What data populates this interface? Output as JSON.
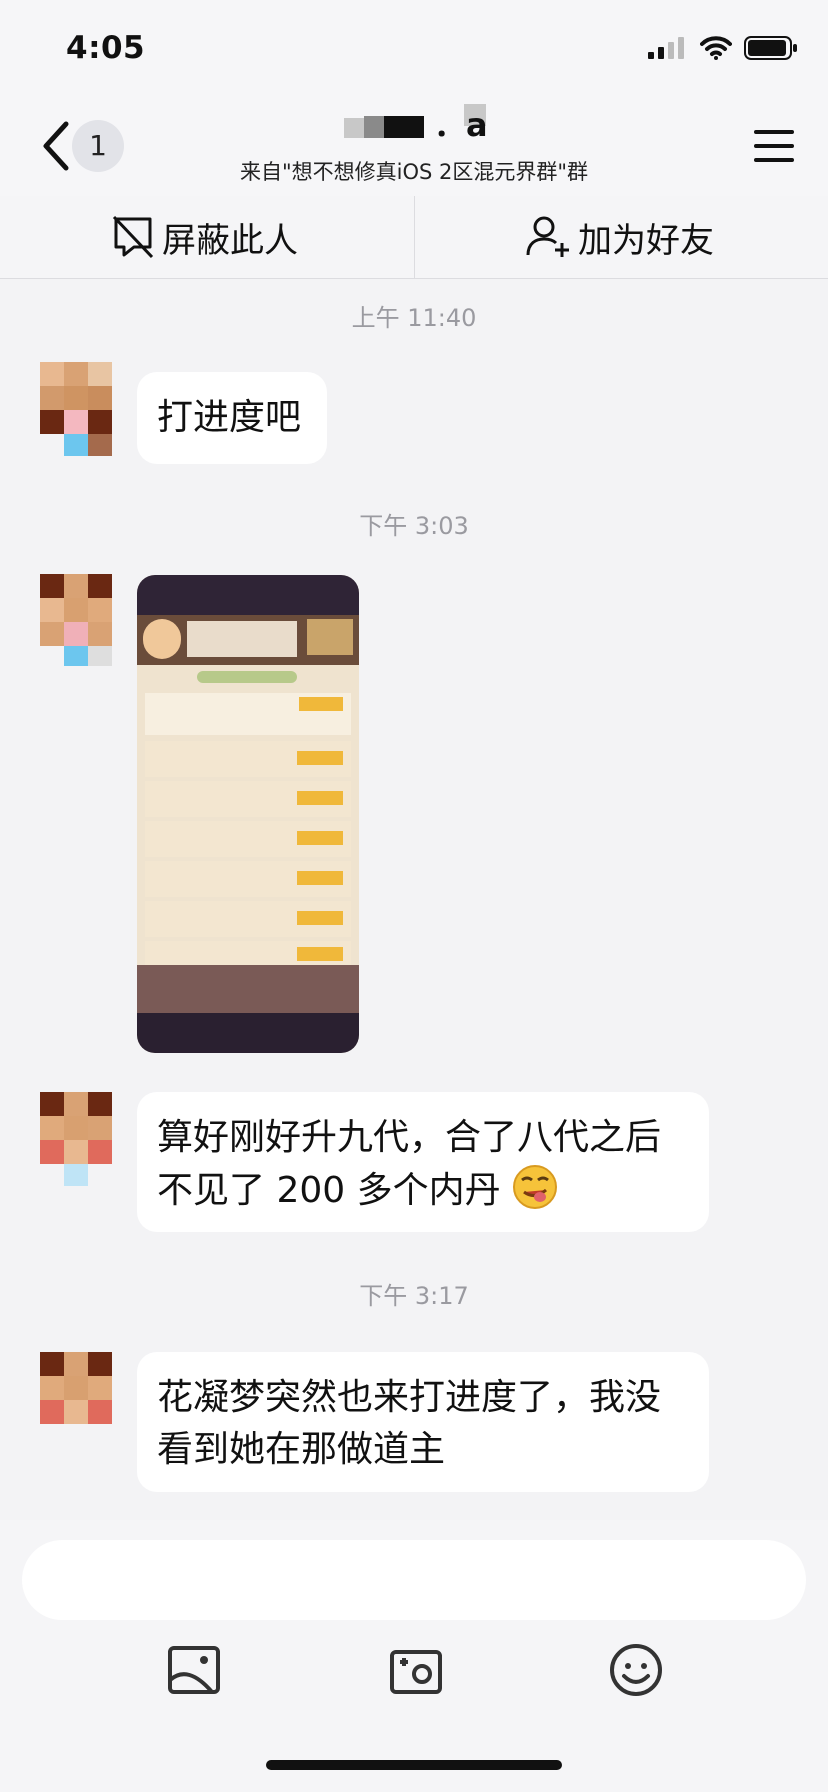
{
  "status": {
    "time": "4:05"
  },
  "header": {
    "unread_count": "1",
    "title": "．a",
    "subtitle": "来自\"想不想修真iOS 2区混元界群\"群"
  },
  "actions": {
    "block_label": "屏蔽此人",
    "add_friend_label": "加为好友"
  },
  "messages": [
    {
      "time": "上午 11:40",
      "text": "打进度吧"
    },
    {
      "time": "下午 3:03",
      "type": "image"
    },
    {
      "text": "算好刚好升九代，合了八代之后不见了 200 多个内丹"
    },
    {
      "time": "下午 3:17",
      "text": "花凝梦突然也来打进度了，我没看到她在那做道主"
    }
  ],
  "emoji": "face-with-tongue-emoji",
  "toolbar": [
    "photo-icon",
    "camera-icon",
    "emoji-icon"
  ],
  "colors": {
    "background": "#f3f3f5",
    "bubble": "#ffffff",
    "time": "#9a9aa0"
  }
}
